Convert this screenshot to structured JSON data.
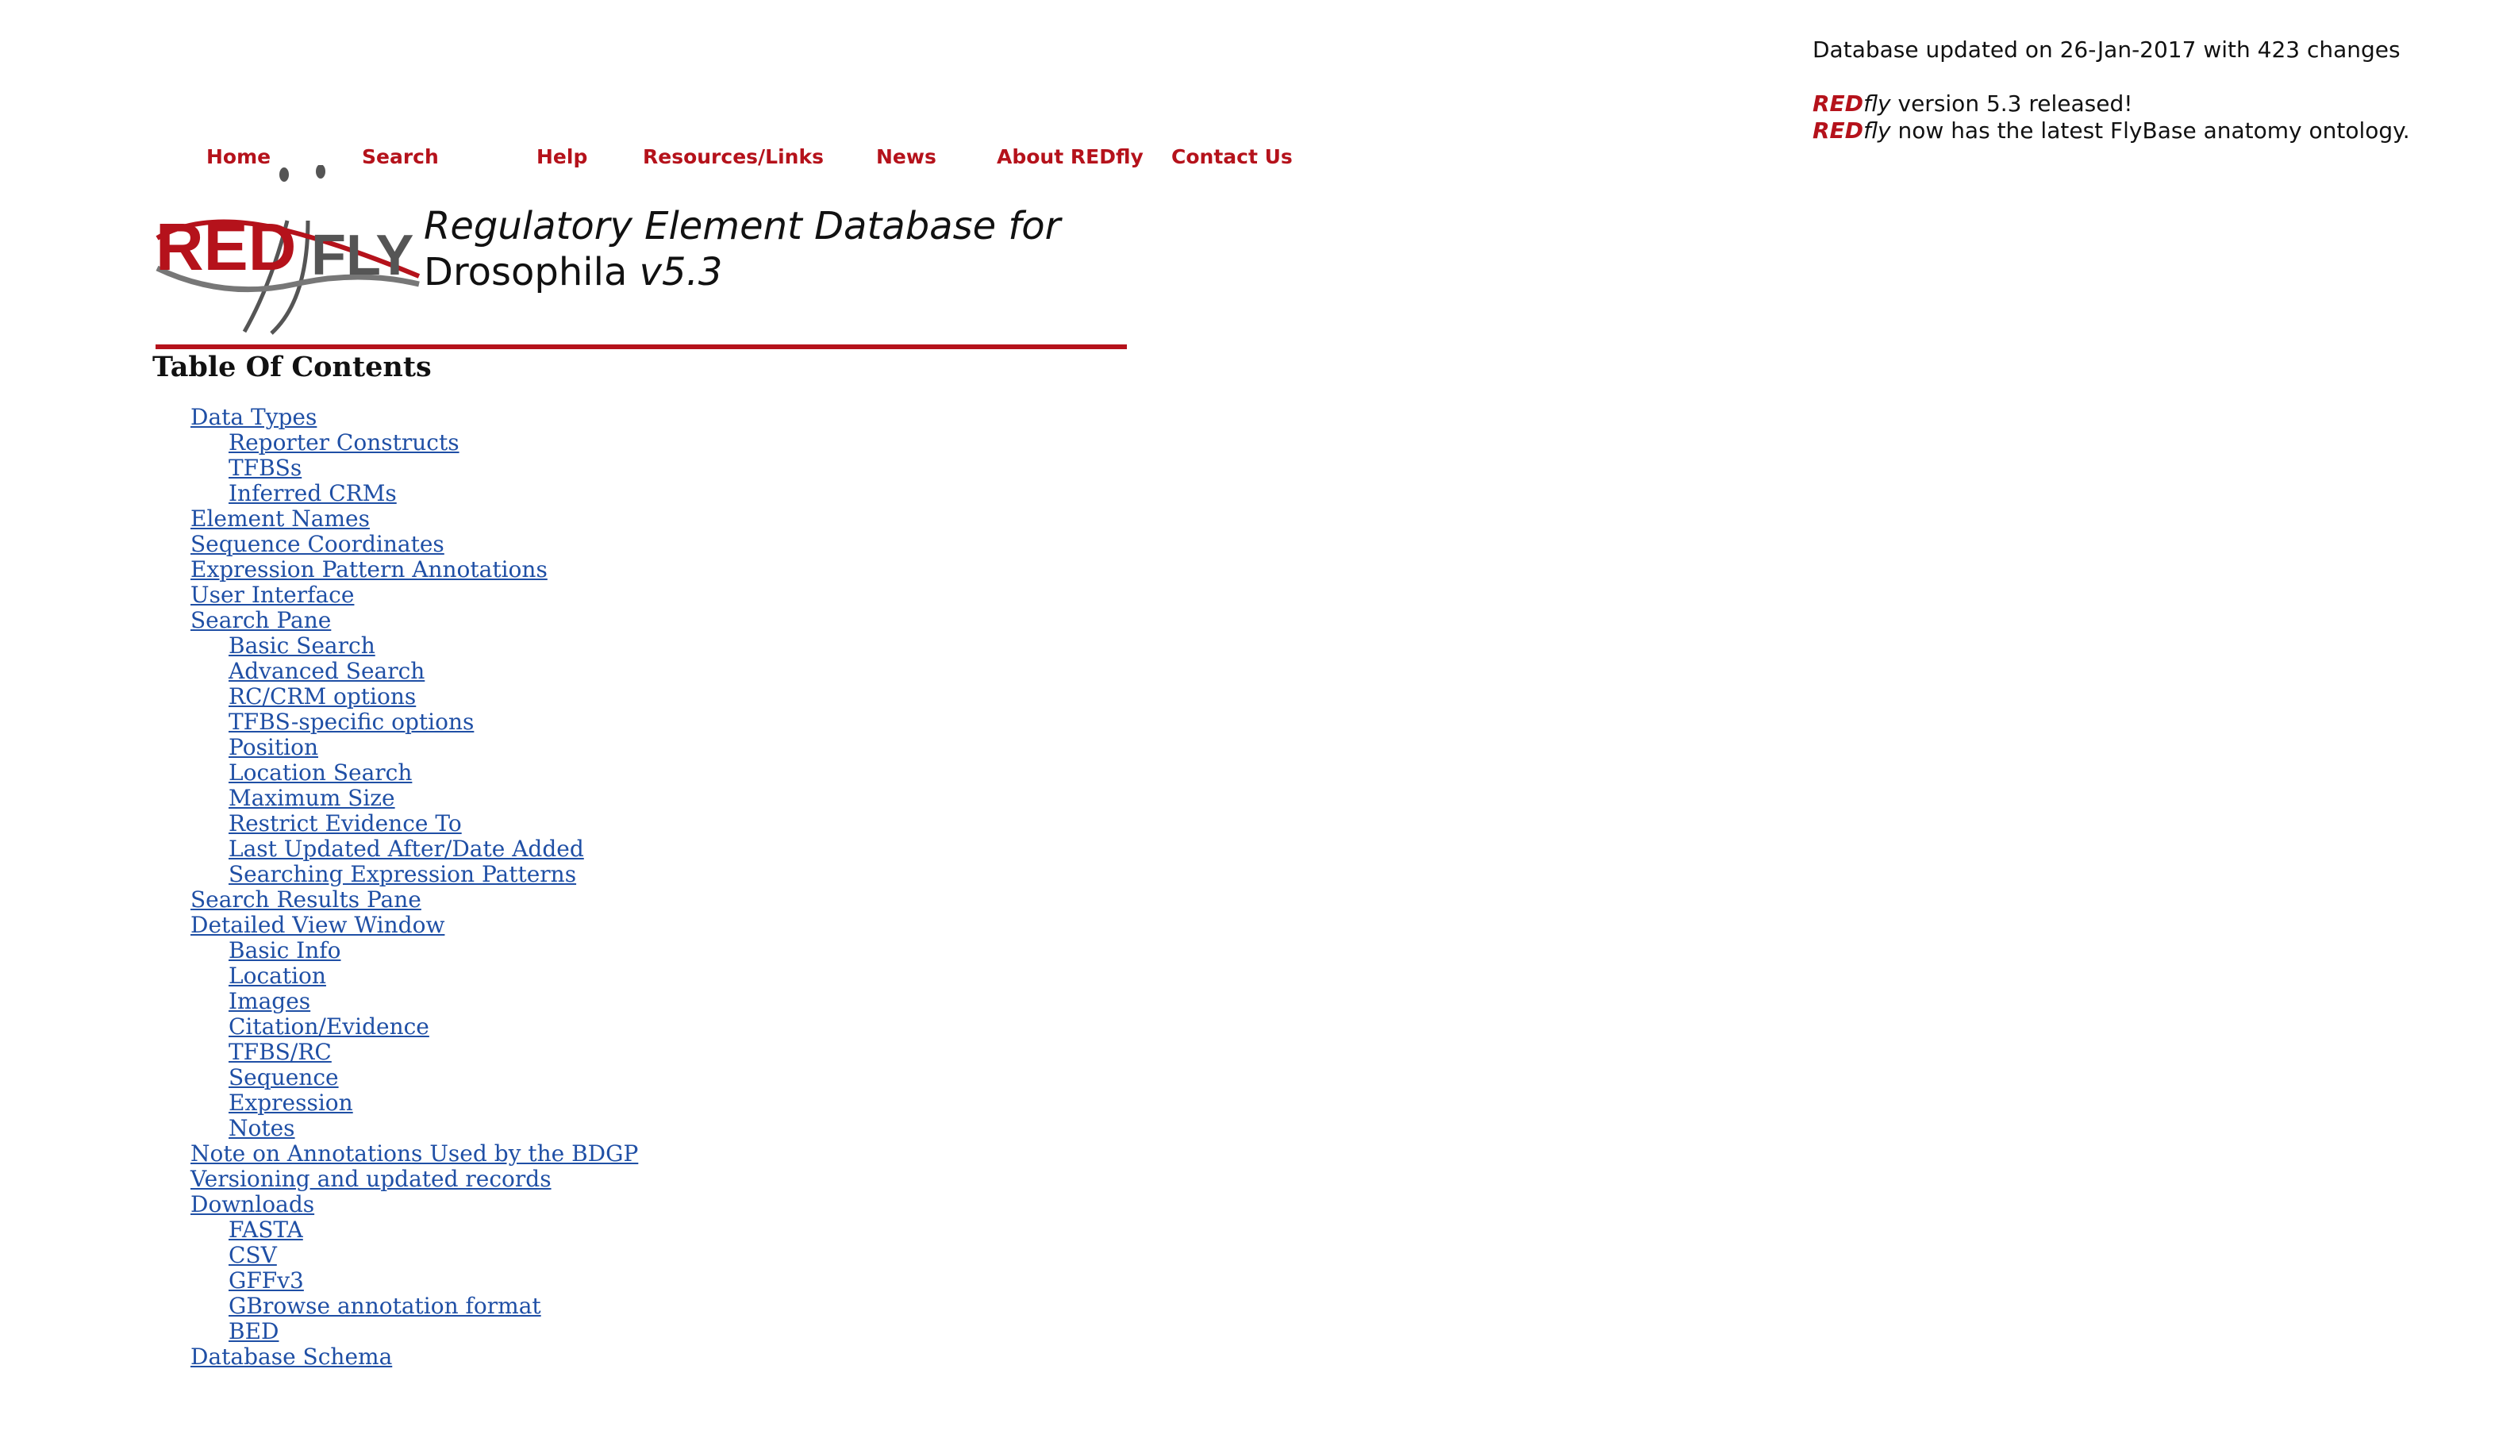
{
  "notice": {
    "updated": "Database updated on 26-Jan-2017 with 423 changes",
    "brand_red": "RED",
    "brand_fly": "fly",
    "line2_rest": " version 5.3 released!",
    "line3_rest": " now has the latest FlyBase anatomy ontology."
  },
  "nav": {
    "items": [
      {
        "label": "Home"
      },
      {
        "label": "Search"
      },
      {
        "label": "Help"
      },
      {
        "label": "Resources/Links"
      },
      {
        "label": "News"
      },
      {
        "label": "About REDfly"
      },
      {
        "label": "Contact Us"
      }
    ]
  },
  "logo": {
    "red_text": "RED",
    "fly_text": "FLY"
  },
  "title": {
    "line1": "Regulatory Element Database for",
    "line2_plain": "Drosophila ",
    "line2_italic": "v5.3"
  },
  "toc": {
    "heading": "Table Of Contents",
    "items": [
      {
        "label": "Data Types",
        "level": 0
      },
      {
        "label": "Reporter Constructs",
        "level": 1
      },
      {
        "label": "TFBSs",
        "level": 1
      },
      {
        "label": "Inferred CRMs",
        "level": 1
      },
      {
        "label": "Element Names",
        "level": 0
      },
      {
        "label": "Sequence Coordinates",
        "level": 0
      },
      {
        "label": "Expression Pattern Annotations",
        "level": 0
      },
      {
        "label": "User Interface",
        "level": 0
      },
      {
        "label": "Search Pane",
        "level": 0
      },
      {
        "label": "Basic Search",
        "level": 1
      },
      {
        "label": "Advanced Search",
        "level": 1
      },
      {
        "label": "RC/CRM options",
        "level": 1
      },
      {
        "label": "TFBS-specific options",
        "level": 1
      },
      {
        "label": "Position",
        "level": 1
      },
      {
        "label": "Location Search",
        "level": 1
      },
      {
        "label": "Maximum Size",
        "level": 1
      },
      {
        "label": "Restrict Evidence To",
        "level": 1
      },
      {
        "label": "Last Updated After/Date Added",
        "level": 1
      },
      {
        "label": "Searching Expression Patterns",
        "level": 1
      },
      {
        "label": "Search Results Pane",
        "level": 0
      },
      {
        "label": "Detailed View Window",
        "level": 0
      },
      {
        "label": "Basic Info",
        "level": 1
      },
      {
        "label": "Location",
        "level": 1
      },
      {
        "label": "Images",
        "level": 1
      },
      {
        "label": "Citation/Evidence",
        "level": 1
      },
      {
        "label": "TFBS/RC",
        "level": 1
      },
      {
        "label": "Sequence",
        "level": 1
      },
      {
        "label": "Expression",
        "level": 1
      },
      {
        "label": "Notes",
        "level": 1
      },
      {
        "label": "Note on Annotations Used by the BDGP",
        "level": 0
      },
      {
        "label": "Versioning and updated records",
        "level": 0
      },
      {
        "label": "Downloads",
        "level": 0
      },
      {
        "label": "FASTA",
        "level": 1
      },
      {
        "label": "CSV",
        "level": 1
      },
      {
        "label": "GFFv3",
        "level": 1
      },
      {
        "label": "GBrowse annotation format",
        "level": 1
      },
      {
        "label": "BED",
        "level": 1
      },
      {
        "label": "Database Schema",
        "level": 0
      }
    ]
  },
  "colors": {
    "brand_red": "#b5121b",
    "link_blue": "#1f4fa5",
    "logo_gray": "#555555"
  }
}
